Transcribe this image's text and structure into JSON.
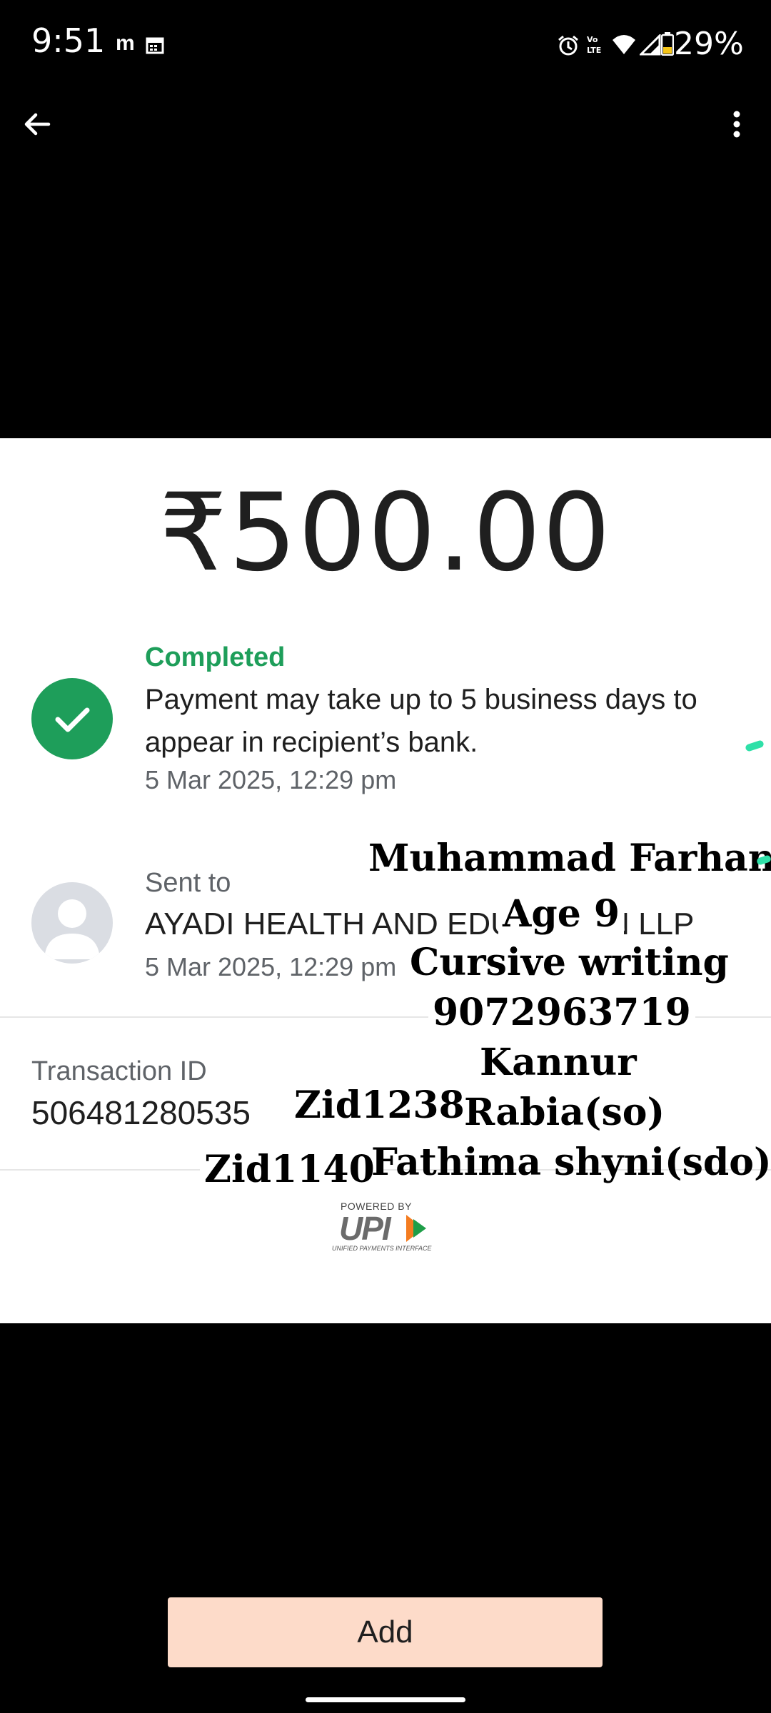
{
  "status_bar": {
    "time": "9:51",
    "app_icon_1": "m",
    "battery_percent": "29%",
    "icons": [
      "alarm-icon",
      "volte-icon",
      "wifi-icon",
      "signal-icon",
      "battery-icon"
    ]
  },
  "top_bar": {
    "back_icon": "arrow-left-icon",
    "more_icon": "more-vert-icon"
  },
  "payment": {
    "amount": "₹500.00",
    "status_label": "Completed",
    "status_message": "Payment may take up to 5 business days to appear in recipient’s bank.",
    "status_date": "5 Mar 2025, 12:29 pm",
    "sent_to_label": "Sent to",
    "recipient_name": "AYADI HEALTH AND EDUCATION LLP",
    "sent_date": "5 Mar 2025, 12:29 pm",
    "transaction_id_label": "Transaction ID",
    "transaction_id": "506481280535",
    "powered_by": "POWERED BY",
    "upi_text": "UPI",
    "upi_subtext": "UNIFIED PAYMENTS INTERFACE"
  },
  "overlay": {
    "name": "Muhammad Farhan",
    "age": "Age 9",
    "subject": "Cursive writing",
    "phone": "9072963719",
    "place": "Kannur",
    "zid_1": "Zid1238",
    "parent_1": "Rabia(so)",
    "zid_2": "Zid1140",
    "parent_2": "Fathima shyni(sdo)"
  },
  "bottom": {
    "add_button_label": "Add"
  },
  "colors": {
    "success_green": "#1e9e5a",
    "add_button_bg": "#fddbc9",
    "text_primary": "#1f1f1f",
    "text_secondary": "#5f6368"
  }
}
